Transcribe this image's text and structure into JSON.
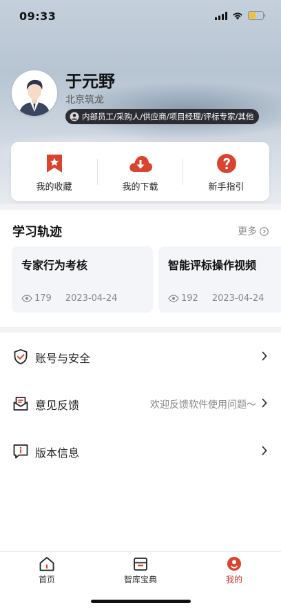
{
  "status_bar": {
    "time": "09:33"
  },
  "profile": {
    "name": "于元野",
    "company": "北京筑龙",
    "role": "内部员工/采购人/供应商/项目经理/评标专家/其他"
  },
  "quick_actions": [
    {
      "label": "我的收藏",
      "icon": "bookmark-star-icon"
    },
    {
      "label": "我的下载",
      "icon": "cloud-download-icon"
    },
    {
      "label": "新手指引",
      "icon": "help-question-icon"
    }
  ],
  "learning": {
    "title": "学习轨迹",
    "more_label": "更多",
    "courses": [
      {
        "title": "专家行为考核",
        "views": "179",
        "date": "2023-04-24"
      },
      {
        "title": "智能评标操作视频",
        "views": "192",
        "date": "2023-04-24"
      }
    ]
  },
  "menu": [
    {
      "label": "账号与安全",
      "hint": "",
      "icon": "shield-check-icon"
    },
    {
      "label": "意见反馈",
      "hint": "欢迎反馈软件使用问题～",
      "icon": "feedback-icon"
    },
    {
      "label": "版本信息",
      "hint": "",
      "icon": "info-message-icon"
    }
  ],
  "tabs": [
    {
      "label": "首页",
      "icon": "home-icon"
    },
    {
      "label": "智库宝典",
      "icon": "box-icon"
    },
    {
      "label": "我的",
      "icon": "profile-icon",
      "active": true
    }
  ],
  "colors": {
    "accent": "#c8362b",
    "badge_bg": "#2b2d33",
    "card_bg": "#f4f5f8"
  }
}
